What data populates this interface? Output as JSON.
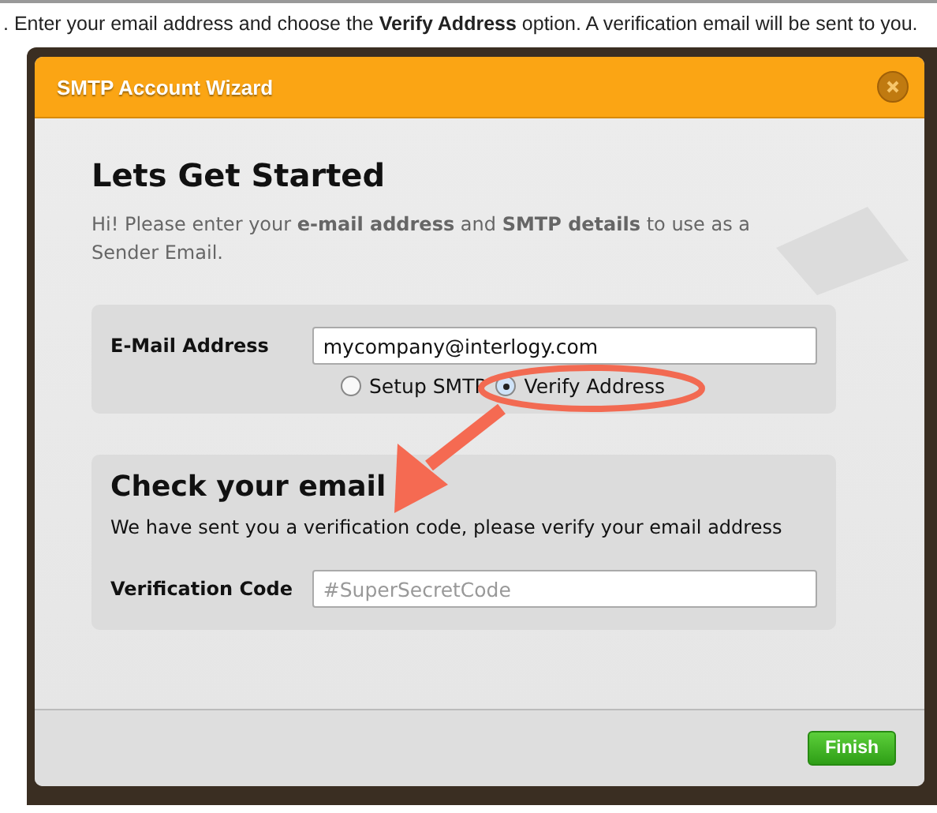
{
  "instruction": ". Enter your email address and choose the **Verify Address** option. A verification email will be sent to you.",
  "dialog": {
    "title": "SMTP Account Wizard",
    "intro": {
      "heading": "Lets Get Started",
      "text": "Hi! Please enter your **e-mail address** and **SMTP details** to use as a Sender Email."
    },
    "email": {
      "label": "E-Mail Address",
      "value": "mycompany@interlogy.com"
    },
    "options": [
      {
        "label": "Setup SMTP",
        "selected": false
      },
      {
        "label": "Verify Address",
        "selected": true
      }
    ],
    "check": {
      "heading": "Check your email",
      "text": "We have sent you a verification code, please verify your email address",
      "label": "Verification Code",
      "placeholder": "#SuperSecretCode"
    },
    "finish": "Finish"
  }
}
